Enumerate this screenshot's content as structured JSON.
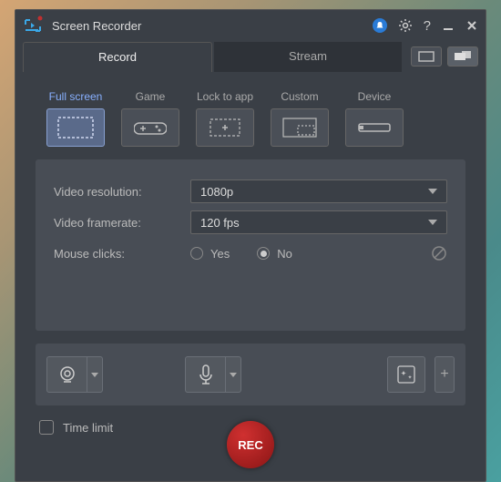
{
  "title": "Screen Recorder",
  "tabs": {
    "record": "Record",
    "stream": "Stream"
  },
  "modes": {
    "fullscreen": "Full screen",
    "game": "Game",
    "lock": "Lock to app",
    "custom": "Custom",
    "device": "Device"
  },
  "settings": {
    "resolution_label": "Video resolution:",
    "resolution_value": "1080p",
    "framerate_label": "Video framerate:",
    "framerate_value": "120 fps",
    "mouse_label": "Mouse clicks:",
    "mouse_yes": "Yes",
    "mouse_no": "No",
    "mouse_selected": "No"
  },
  "bottom": {
    "time_limit": "Time limit",
    "rec": "REC"
  }
}
